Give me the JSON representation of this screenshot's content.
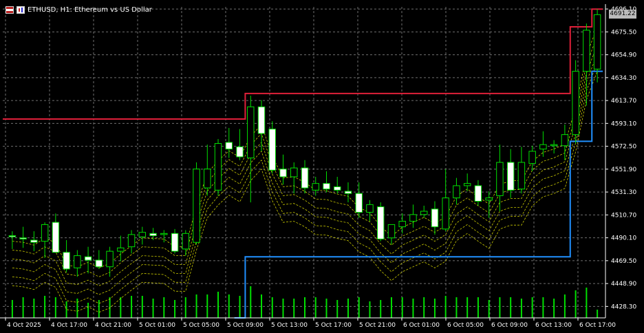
{
  "window": {
    "title": "ETHUSD, H1:  Ethereum vs US Dollar",
    "icons": [
      "flag-icon",
      "chart-icon"
    ]
  },
  "colors": {
    "background": "#000000",
    "grid": "#707070",
    "bull_body": "#000000",
    "bull_outline": "#00e000",
    "bear_body": "#ffffff",
    "upper_channel": "#e0203a",
    "lower_channel": "#2090ff",
    "bands": "#e0e000",
    "volume": "#00e000",
    "axis_text": "#ffffff"
  },
  "current_price_label": "4691.22",
  "chart_data": {
    "type": "candlestick",
    "symbol": "ETHUSD",
    "timeframe": "H1",
    "y_axis_ticks": [
      "4696.10",
      "4675.50",
      "4654.90",
      "4634.30",
      "4613.70",
      "4593.10",
      "4572.50",
      "4551.90",
      "4531.30",
      "4510.70",
      "4490.10",
      "4469.50",
      "4448.90",
      "4428.30"
    ],
    "x_axis_ticks": [
      "4 Oct 2025",
      "4 Oct 17:00",
      "4 Oct 21:00",
      "5 Oct 01:00",
      "5 Oct 05:00",
      "5 Oct 09:00",
      "5 Oct 13:00",
      "5 Oct 17:00",
      "5 Oct 21:00",
      "6 Oct 01:00",
      "6 Oct 05:00",
      "6 Oct 09:00",
      "6 Oct 13:00",
      "6 Oct 17:00"
    ],
    "ylim": [
      4418,
      4698
    ],
    "candles": [
      {
        "o": 4492,
        "h": 4496,
        "l": 4480,
        "c": 4491
      },
      {
        "o": 4490,
        "h": 4500,
        "l": 4481,
        "c": 4489
      },
      {
        "o": 4488,
        "h": 4496,
        "l": 4478,
        "c": 4486
      },
      {
        "o": 4487,
        "h": 4504,
        "l": 4472,
        "c": 4502
      },
      {
        "o": 4504,
        "h": 4512,
        "l": 4478,
        "c": 4477
      },
      {
        "o": 4477,
        "h": 4488,
        "l": 4459,
        "c": 4462
      },
      {
        "o": 4463,
        "h": 4479,
        "l": 4455,
        "c": 4474
      },
      {
        "o": 4473,
        "h": 4482,
        "l": 4458,
        "c": 4470
      },
      {
        "o": 4470,
        "h": 4479,
        "l": 4462,
        "c": 4464
      },
      {
        "o": 4464,
        "h": 4482,
        "l": 4455,
        "c": 4478
      },
      {
        "o": 4478,
        "h": 4492,
        "l": 4469,
        "c": 4481
      },
      {
        "o": 4482,
        "h": 4497,
        "l": 4476,
        "c": 4493
      },
      {
        "o": 4491,
        "h": 4500,
        "l": 4484,
        "c": 4495
      },
      {
        "o": 4494,
        "h": 4499,
        "l": 4488,
        "c": 4492
      },
      {
        "o": 4493,
        "h": 4497,
        "l": 4486,
        "c": 4494
      },
      {
        "o": 4494,
        "h": 4498,
        "l": 4476,
        "c": 4478
      },
      {
        "o": 4480,
        "h": 4497,
        "l": 4474,
        "c": 4494
      },
      {
        "o": 4486,
        "h": 4558,
        "l": 4484,
        "c": 4552
      },
      {
        "o": 4535,
        "h": 4574,
        "l": 4528,
        "c": 4552
      },
      {
        "o": 4533,
        "h": 4579,
        "l": 4528,
        "c": 4575
      },
      {
        "o": 4576,
        "h": 4589,
        "l": 4562,
        "c": 4570
      },
      {
        "o": 4572,
        "h": 4588,
        "l": 4560,
        "c": 4563
      },
      {
        "o": 4562,
        "h": 4618,
        "l": 4522,
        "c": 4608
      },
      {
        "o": 4608,
        "h": 4614,
        "l": 4568,
        "c": 4584
      },
      {
        "o": 4588,
        "h": 4595,
        "l": 4548,
        "c": 4551
      },
      {
        "o": 4552,
        "h": 4565,
        "l": 4538,
        "c": 4545
      },
      {
        "o": 4545,
        "h": 4558,
        "l": 4530,
        "c": 4553
      },
      {
        "o": 4553,
        "h": 4560,
        "l": 4530,
        "c": 4535
      },
      {
        "o": 4533,
        "h": 4545,
        "l": 4528,
        "c": 4539
      },
      {
        "o": 4539,
        "h": 4550,
        "l": 4531,
        "c": 4534
      },
      {
        "o": 4536,
        "h": 4545,
        "l": 4530,
        "c": 4533
      },
      {
        "o": 4532,
        "h": 4540,
        "l": 4522,
        "c": 4530
      },
      {
        "o": 4530,
        "h": 4540,
        "l": 4508,
        "c": 4513
      },
      {
        "o": 4513,
        "h": 4524,
        "l": 4505,
        "c": 4520
      },
      {
        "o": 4518,
        "h": 4522,
        "l": 4487,
        "c": 4489
      },
      {
        "o": 4490,
        "h": 4500,
        "l": 4484,
        "c": 4502
      },
      {
        "o": 4500,
        "h": 4512,
        "l": 4494,
        "c": 4505
      },
      {
        "o": 4505,
        "h": 4520,
        "l": 4499,
        "c": 4511
      },
      {
        "o": 4511,
        "h": 4519,
        "l": 4508,
        "c": 4514
      },
      {
        "o": 4516,
        "h": 4523,
        "l": 4493,
        "c": 4500
      },
      {
        "o": 4498,
        "h": 4552,
        "l": 4496,
        "c": 4526
      },
      {
        "o": 4526,
        "h": 4544,
        "l": 4520,
        "c": 4537
      },
      {
        "o": 4537,
        "h": 4548,
        "l": 4532,
        "c": 4539
      },
      {
        "o": 4537,
        "h": 4542,
        "l": 4519,
        "c": 4523
      },
      {
        "o": 4524,
        "h": 4532,
        "l": 4508,
        "c": 4526
      },
      {
        "o": 4528,
        "h": 4574,
        "l": 4514,
        "c": 4558
      },
      {
        "o": 4558,
        "h": 4570,
        "l": 4526,
        "c": 4533
      },
      {
        "o": 4534,
        "h": 4572,
        "l": 4530,
        "c": 4558
      },
      {
        "o": 4557,
        "h": 4573,
        "l": 4550,
        "c": 4568
      },
      {
        "o": 4570,
        "h": 4586,
        "l": 4563,
        "c": 4574
      },
      {
        "o": 4573,
        "h": 4578,
        "l": 4566,
        "c": 4574
      },
      {
        "o": 4573,
        "h": 4592,
        "l": 4560,
        "c": 4583
      },
      {
        "o": 4583,
        "h": 4650,
        "l": 4575,
        "c": 4640
      },
      {
        "o": 4640,
        "h": 4683,
        "l": 4609,
        "c": 4677
      },
      {
        "o": 4642,
        "h": 4696,
        "l": 4630,
        "c": 4691
      }
    ],
    "volume": [
      26,
      30,
      28,
      32,
      30,
      24,
      28,
      22,
      26,
      30,
      30,
      32,
      32,
      28,
      30,
      26,
      30,
      34,
      34,
      38,
      34,
      32,
      46,
      34,
      30,
      28,
      28,
      30,
      30,
      28,
      26,
      28,
      30,
      24,
      26,
      30,
      30,
      28,
      30,
      28,
      32,
      30,
      30,
      30,
      26,
      30,
      30,
      28,
      30,
      30,
      28,
      34,
      40,
      44,
      12
    ],
    "upper_channel": [
      4597,
      4597,
      4597,
      4597,
      4597,
      4597,
      4597,
      4597,
      4597,
      4597,
      4597,
      4597,
      4597,
      4597,
      4597,
      4597,
      4597,
      4597,
      4597,
      4597,
      4597,
      4597,
      4620,
      4620,
      4620,
      4620,
      4620,
      4620,
      4620,
      4620,
      4620,
      4620,
      4620,
      4620,
      4620,
      4620,
      4620,
      4620,
      4620,
      4620,
      4620,
      4620,
      4620,
      4620,
      4620,
      4620,
      4620,
      4620,
      4620,
      4620,
      4620,
      4620,
      4680,
      4680,
      4696
    ],
    "lower_channel": [
      null,
      null,
      null,
      null,
      null,
      null,
      null,
      null,
      null,
      null,
      null,
      null,
      null,
      null,
      null,
      null,
      null,
      null,
      null,
      null,
      null,
      4418,
      4473,
      4473,
      4473,
      4473,
      4473,
      4473,
      4473,
      4473,
      4473,
      4473,
      4473,
      4473,
      4473,
      4473,
      4473,
      4473,
      4473,
      4473,
      4473,
      4473,
      4473,
      4473,
      4473,
      4473,
      4473,
      4473,
      4473,
      4473,
      4473,
      4473,
      4577,
      4577,
      4640
    ]
  }
}
